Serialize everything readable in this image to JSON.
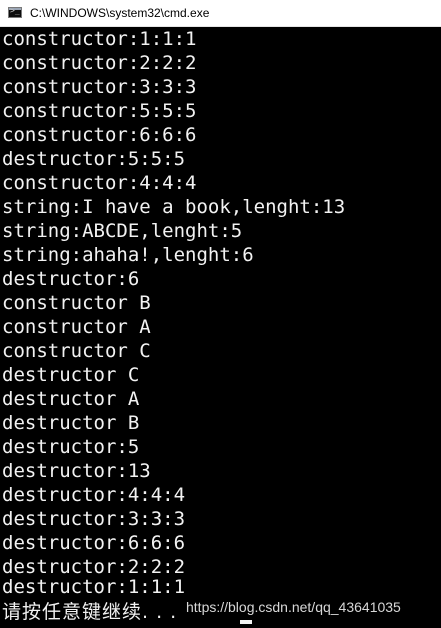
{
  "window": {
    "title": "C:\\WINDOWS\\system32\\cmd.exe",
    "icon": "cmd-console-icon"
  },
  "console": {
    "lines": [
      "constructor:1:1:1",
      "constructor:2:2:2",
      "constructor:3:3:3",
      "constructor:5:5:5",
      "constructor:6:6:6",
      "destructor:5:5:5",
      "constructor:4:4:4",
      "string:I have a book,lenght:13",
      "string:ABCDE,lenght:5",
      "string:ahaha!,lenght:6",
      "destructor:6",
      "constructor B",
      "constructor A",
      "constructor C",
      "destructor C",
      "destructor A",
      "destructor B",
      "destructor:5",
      "destructor:13",
      "destructor:4:4:4",
      "destructor:3:3:3",
      "destructor:6:6:6",
      "destructor:2:2:2",
      "destructor:1:1:1"
    ],
    "prompt": "请按任意键继续. . ."
  },
  "watermark": {
    "text": "https://blog.csdn.net/qq_43641035"
  },
  "colors": {
    "console_bg": "#000000",
    "console_fg": "#f2f2f2",
    "titlebar_bg": "#ffffff"
  }
}
